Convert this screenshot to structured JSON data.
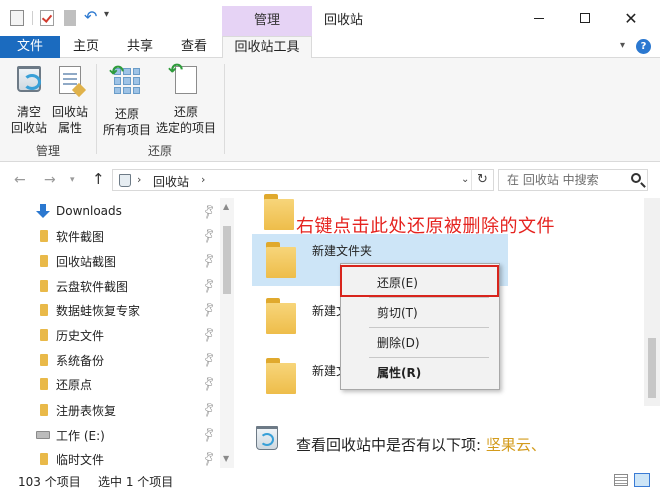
{
  "window": {
    "title": "回收站",
    "context_tab_group": "管理"
  },
  "tabs": [
    {
      "label": "文件"
    },
    {
      "label": "主页"
    },
    {
      "label": "共享"
    },
    {
      "label": "查看"
    },
    {
      "label": "回收站工具"
    }
  ],
  "ribbon": {
    "empty_bin": {
      "line1": "清空",
      "line2": "回收站"
    },
    "bin_props": {
      "line1": "回收站",
      "line2": "属性"
    },
    "restore_all": {
      "line1": "还原",
      "line2": "所有项目"
    },
    "restore_selected": {
      "line1": "还原",
      "line2": "选定的项目"
    },
    "group_manage": "管理",
    "group_restore": "还原"
  },
  "address": {
    "path": "回收站",
    "search_placeholder": "在 回收站 中搜索"
  },
  "nav": {
    "items": [
      {
        "label": "Downloads",
        "icon": "download-arrow-icon"
      },
      {
        "label": "软件截图",
        "icon": "folder-icon"
      },
      {
        "label": "回收站截图",
        "icon": "folder-icon"
      },
      {
        "label": "云盘软件截图",
        "icon": "folder-icon"
      },
      {
        "label": "数据蛙恢复专家",
        "icon": "folder-icon"
      },
      {
        "label": "历史文件",
        "icon": "folder-icon"
      },
      {
        "label": "系统备份",
        "icon": "folder-icon"
      },
      {
        "label": "还原点",
        "icon": "folder-icon"
      },
      {
        "label": "注册表恢复",
        "icon": "folder-icon"
      },
      {
        "label": "工作 (E:)",
        "icon": "drive-icon"
      },
      {
        "label": "临时文件",
        "icon": "folder-icon"
      }
    ]
  },
  "content": {
    "annotation": "右键点击此处还原被删除的文件",
    "folders": [
      {
        "label": "新建文件夹"
      },
      {
        "label": "新建文件夹"
      },
      {
        "label": "新建文件夹"
      }
    ],
    "caption_main": "查看回收站中是否有以下项: ",
    "caption_tail": "坚果云、"
  },
  "context_menu": {
    "restore": "还原(E)",
    "cut": "剪切(T)",
    "delete": "删除(D)",
    "properties": "属性(R)"
  },
  "status": {
    "count": "103 个项目",
    "selected": "选中 1 个项目"
  },
  "colors": {
    "file_tab": "#1b6bbf",
    "context_tab": "#e6d3f5",
    "annotation": "#e5231f",
    "selection": "#cde5f7",
    "highlight_box": "#d8241c",
    "caption_tail": "#d39b1c"
  }
}
